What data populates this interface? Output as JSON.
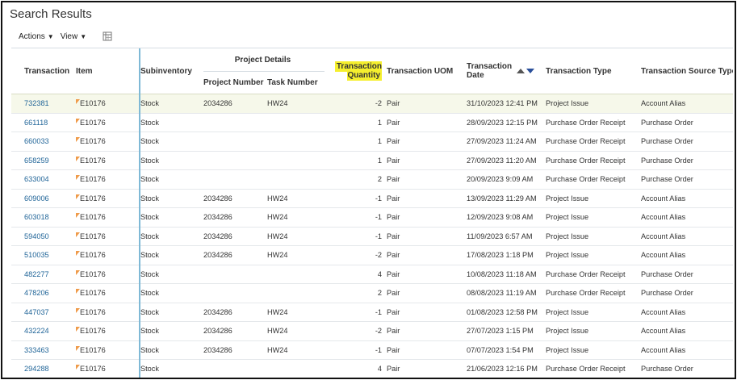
{
  "page": {
    "title": "Search Results"
  },
  "toolbar": {
    "actions_label": "Actions",
    "view_label": "View",
    "icon": "freeze-columns-icon"
  },
  "columns": {
    "transaction": "Transaction",
    "item": "Item",
    "subinventory": "Subinventory",
    "project_details": "Project Details",
    "project_number": "Project Number",
    "task_number": "Task Number",
    "quantity_line1": "Transaction",
    "quantity_line2": "Quantity",
    "uom": "Transaction UOM",
    "date_line1": "Transaction",
    "date_line2": "Date",
    "type": "Transaction Type",
    "source_type": "Transaction Source Type"
  },
  "colors": {
    "link": "#226699",
    "highlight": "#f5ef2e",
    "selected_row": "#f6f8ea",
    "frozen_divider": "#7fb9d6"
  },
  "rows": [
    {
      "transaction": "732381",
      "item": "E10176",
      "subinventory": "Stock",
      "project_number": "2034286",
      "task_number": "HW24",
      "quantity": "-2",
      "uom": "Pair",
      "date": "31/10/2023 12:41 PM",
      "type": "Project Issue",
      "source_type": "Account Alias"
    },
    {
      "transaction": "661118",
      "item": "E10176",
      "subinventory": "Stock",
      "project_number": "",
      "task_number": "",
      "quantity": "1",
      "uom": "Pair",
      "date": "28/09/2023 12:15 PM",
      "type": "Purchase Order Receipt",
      "source_type": "Purchase Order"
    },
    {
      "transaction": "660033",
      "item": "E10176",
      "subinventory": "Stock",
      "project_number": "",
      "task_number": "",
      "quantity": "1",
      "uom": "Pair",
      "date": "27/09/2023 11:24 AM",
      "type": "Purchase Order Receipt",
      "source_type": "Purchase Order"
    },
    {
      "transaction": "658259",
      "item": "E10176",
      "subinventory": "Stock",
      "project_number": "",
      "task_number": "",
      "quantity": "1",
      "uom": "Pair",
      "date": "27/09/2023 11:20 AM",
      "type": "Purchase Order Receipt",
      "source_type": "Purchase Order"
    },
    {
      "transaction": "633004",
      "item": "E10176",
      "subinventory": "Stock",
      "project_number": "",
      "task_number": "",
      "quantity": "2",
      "uom": "Pair",
      "date": "20/09/2023 9:09 AM",
      "type": "Purchase Order Receipt",
      "source_type": "Purchase Order"
    },
    {
      "transaction": "609006",
      "item": "E10176",
      "subinventory": "Stock",
      "project_number": "2034286",
      "task_number": "HW24",
      "quantity": "-1",
      "uom": "Pair",
      "date": "13/09/2023 11:29 AM",
      "type": "Project Issue",
      "source_type": "Account Alias"
    },
    {
      "transaction": "603018",
      "item": "E10176",
      "subinventory": "Stock",
      "project_number": "2034286",
      "task_number": "HW24",
      "quantity": "-1",
      "uom": "Pair",
      "date": "12/09/2023 9:08 AM",
      "type": "Project Issue",
      "source_type": "Account Alias"
    },
    {
      "transaction": "594050",
      "item": "E10176",
      "subinventory": "Stock",
      "project_number": "2034286",
      "task_number": "HW24",
      "quantity": "-1",
      "uom": "Pair",
      "date": "11/09/2023 6:57 AM",
      "type": "Project Issue",
      "source_type": "Account Alias"
    },
    {
      "transaction": "510035",
      "item": "E10176",
      "subinventory": "Stock",
      "project_number": "2034286",
      "task_number": "HW24",
      "quantity": "-2",
      "uom": "Pair",
      "date": "17/08/2023 1:18 PM",
      "type": "Project Issue",
      "source_type": "Account Alias"
    },
    {
      "transaction": "482277",
      "item": "E10176",
      "subinventory": "Stock",
      "project_number": "",
      "task_number": "",
      "quantity": "4",
      "uom": "Pair",
      "date": "10/08/2023 11:18 AM",
      "type": "Purchase Order Receipt",
      "source_type": "Purchase Order"
    },
    {
      "transaction": "478206",
      "item": "E10176",
      "subinventory": "Stock",
      "project_number": "",
      "task_number": "",
      "quantity": "2",
      "uom": "Pair",
      "date": "08/08/2023 11:19 AM",
      "type": "Purchase Order Receipt",
      "source_type": "Purchase Order"
    },
    {
      "transaction": "447037",
      "item": "E10176",
      "subinventory": "Stock",
      "project_number": "2034286",
      "task_number": "HW24",
      "quantity": "-1",
      "uom": "Pair",
      "date": "01/08/2023 12:58 PM",
      "type": "Project Issue",
      "source_type": "Account Alias"
    },
    {
      "transaction": "432224",
      "item": "E10176",
      "subinventory": "Stock",
      "project_number": "2034286",
      "task_number": "HW24",
      "quantity": "-2",
      "uom": "Pair",
      "date": "27/07/2023 1:15 PM",
      "type": "Project Issue",
      "source_type": "Account Alias"
    },
    {
      "transaction": "333463",
      "item": "E10176",
      "subinventory": "Stock",
      "project_number": "2034286",
      "task_number": "HW24",
      "quantity": "-1",
      "uom": "Pair",
      "date": "07/07/2023 1:54 PM",
      "type": "Project Issue",
      "source_type": "Account Alias"
    },
    {
      "transaction": "294288",
      "item": "E10176",
      "subinventory": "Stock",
      "project_number": "",
      "task_number": "",
      "quantity": "4",
      "uom": "Pair",
      "date": "21/06/2023 12:16 PM",
      "type": "Purchase Order Receipt",
      "source_type": "Purchase Order"
    }
  ]
}
